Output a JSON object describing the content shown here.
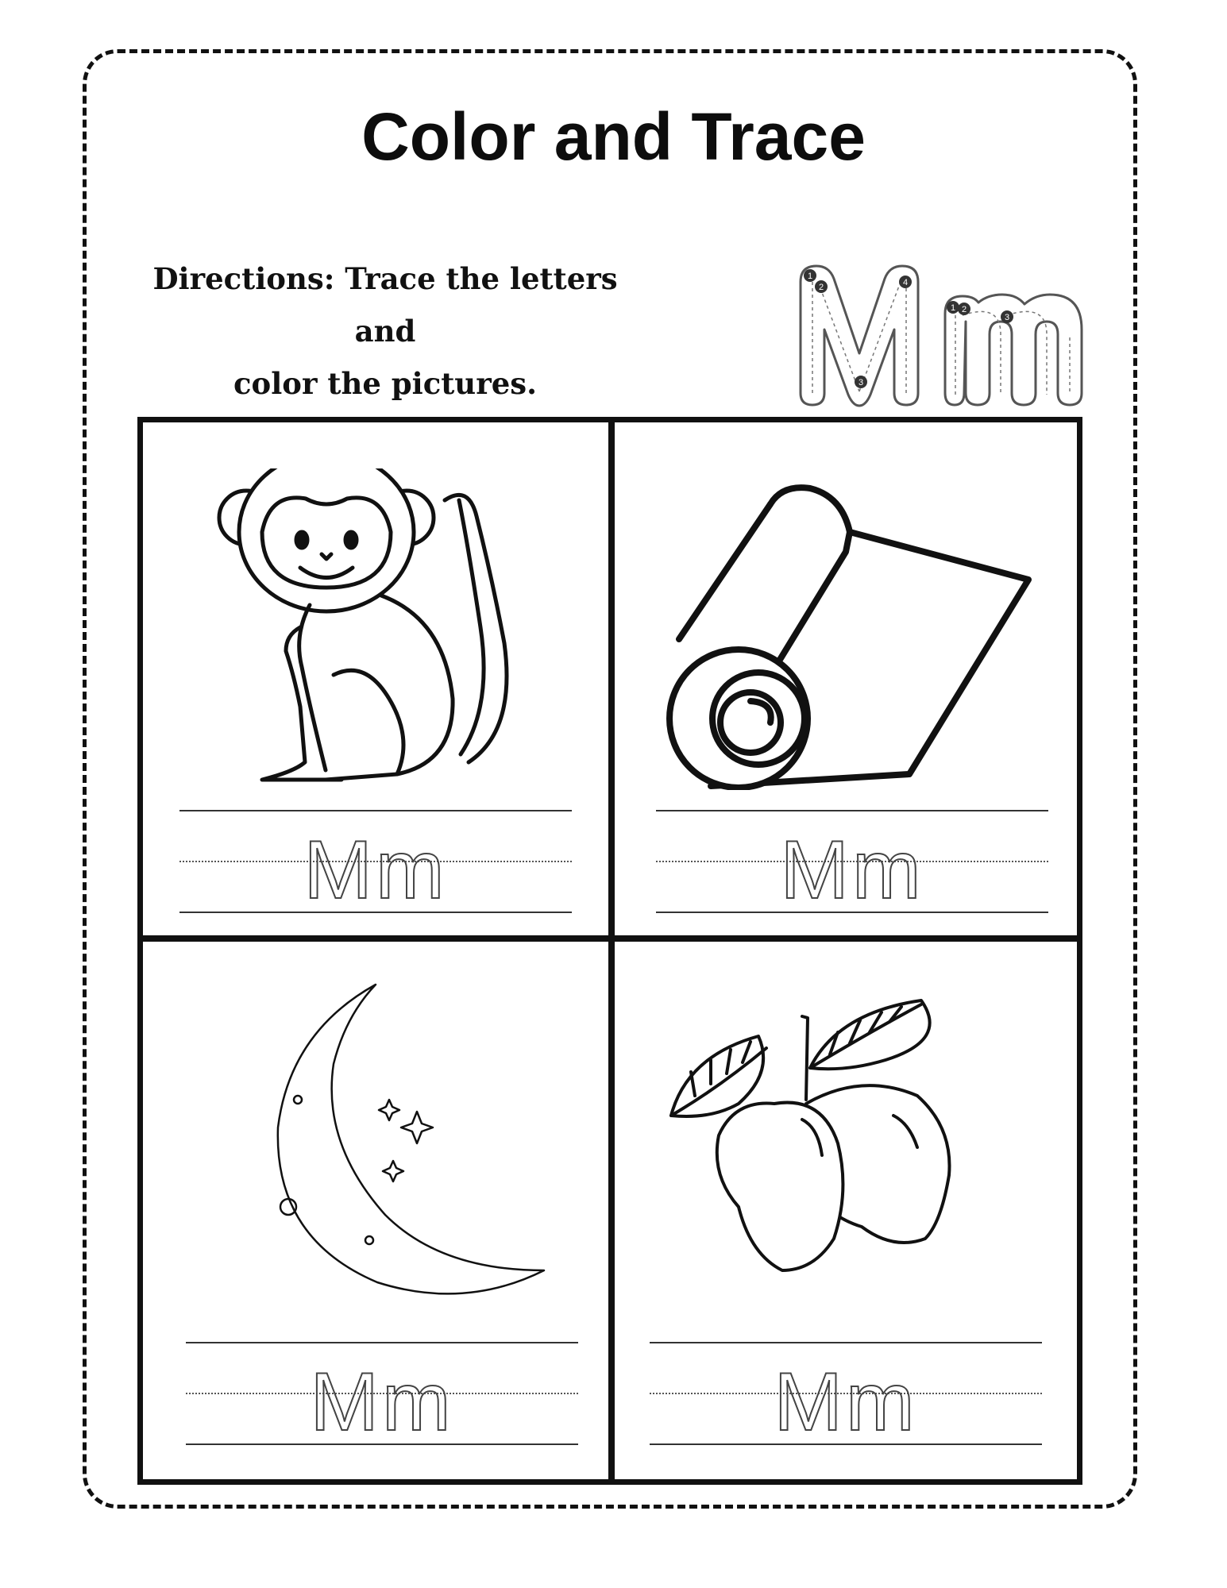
{
  "worksheet": {
    "title": "Color and Trace",
    "directions_line1": "Directions: Trace the letters and",
    "directions_line2": "color the pictures.",
    "guide_letters": "Mm",
    "stroke_numbers": [
      "1",
      "2",
      "3",
      "4",
      "1",
      "2",
      "3"
    ]
  },
  "cells": [
    {
      "picture": "monkey",
      "trace_text": "Mm"
    },
    {
      "picture": "mat-roll",
      "trace_text": "Mm"
    },
    {
      "picture": "moon",
      "trace_text": "Mm"
    },
    {
      "picture": "mango",
      "trace_text": "Mm"
    }
  ]
}
